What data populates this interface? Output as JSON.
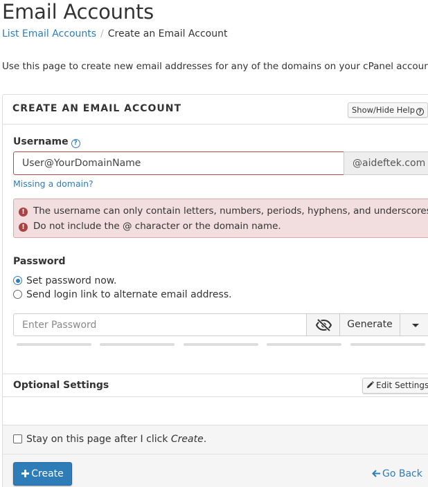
{
  "header": {
    "title": "Email Accounts",
    "breadcrumb": {
      "parent": "List Email Accounts",
      "separator": "/",
      "current": "Create an Email Account"
    },
    "intro": "Use this page to create new email addresses for any of the domains on your cPanel account. W"
  },
  "panel": {
    "title": "CREATE AN EMAIL ACCOUNT",
    "help_label": "Show/Hide Help"
  },
  "username": {
    "label": "Username",
    "value": "User@YourDomainName",
    "domain": "@aideftek.com",
    "missing_domain_link": "Missing a domain?",
    "errors": [
      "The username can only contain letters, numbers, periods, hyphens, and underscores.",
      "Do not include the @ character or the domain name."
    ]
  },
  "password": {
    "label": "Password",
    "options": [
      "Set password now.",
      "Send login link to alternate email address."
    ],
    "selected_option": 0,
    "placeholder": "Enter Password",
    "generate_label": "Generate"
  },
  "optional": {
    "title": "Optional Settings",
    "edit_label": "Edit Settings"
  },
  "footer": {
    "stay_prefix": "Stay on this page after I click ",
    "stay_emphasis": "Create",
    "stay_suffix": ".",
    "create_label": "Create",
    "go_back_label": "Go Back"
  },
  "colors": {
    "link": "#2e7db9",
    "primary_button": "#2e7db9",
    "error_bg": "#f2dede",
    "error_border": "#b94a48",
    "error_icon": "#a94442"
  }
}
